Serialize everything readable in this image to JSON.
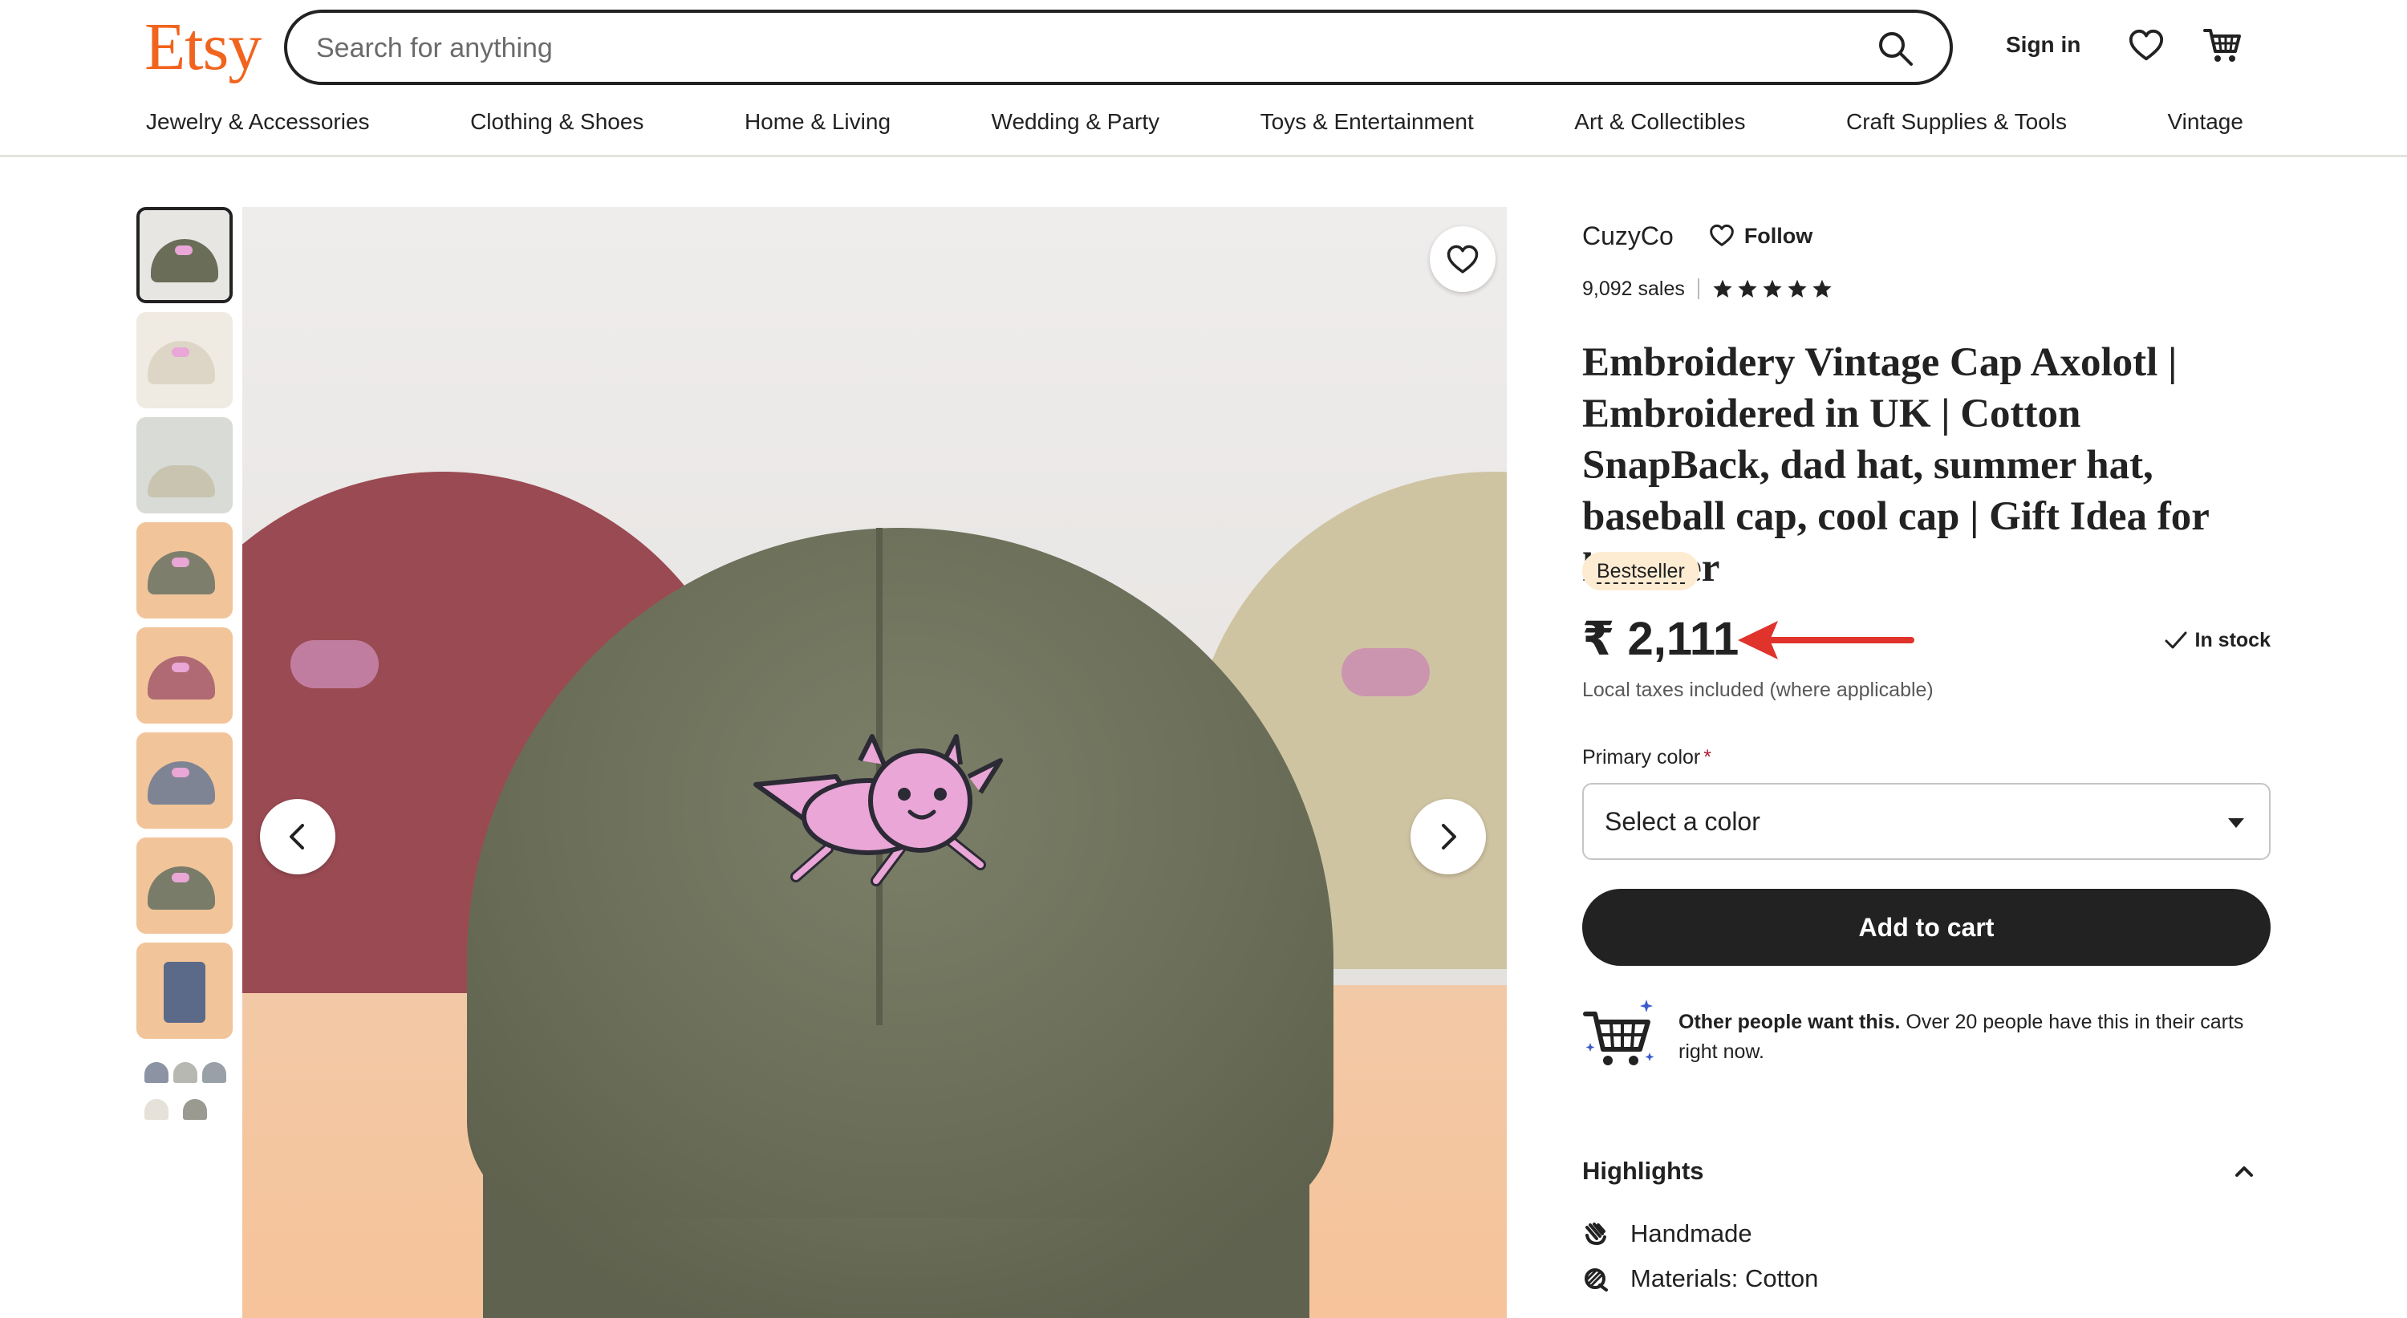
{
  "header": {
    "logo": "Etsy",
    "search_placeholder": "Search for anything",
    "sign_in": "Sign in",
    "categories": [
      "Jewelry & Accessories",
      "Clothing & Shoes",
      "Home & Living",
      "Wedding & Party",
      "Toys & Entertainment",
      "Art & Collectibles",
      "Craft Supplies & Tools",
      "Vintage"
    ]
  },
  "gallery": {
    "thumbnail_count": 9,
    "active_index": 0
  },
  "product": {
    "shop_name": "CuzyCo",
    "follow_label": "Follow",
    "sales": "9,092 sales",
    "rating_stars": 5,
    "title": "Embroidery Vintage Cap Axolotl | Embroidered in UK | Cotton SnapBack, dad hat, summer hat, baseball cap, cool cap | Gift Idea for him her",
    "badge": "Bestseller",
    "price": "₹ 2,111",
    "stock": "In stock",
    "tax_note": "Local taxes included (where applicable)",
    "color_field": {
      "label": "Primary color",
      "required_mark": "*",
      "value": "Select a color"
    },
    "add_to_cart": "Add to cart",
    "promo": {
      "bold": "Other people want this.",
      "text": " Over 20 people have this in their carts right now."
    },
    "highlights": {
      "title": "Highlights",
      "items": [
        "Handmade",
        "Materials: Cotton"
      ]
    }
  },
  "colors": {
    "brand": "#f1641e",
    "annotation_arrow": "#e0332b",
    "badge_bg": "#fdebd2",
    "button_bg": "#222222"
  }
}
